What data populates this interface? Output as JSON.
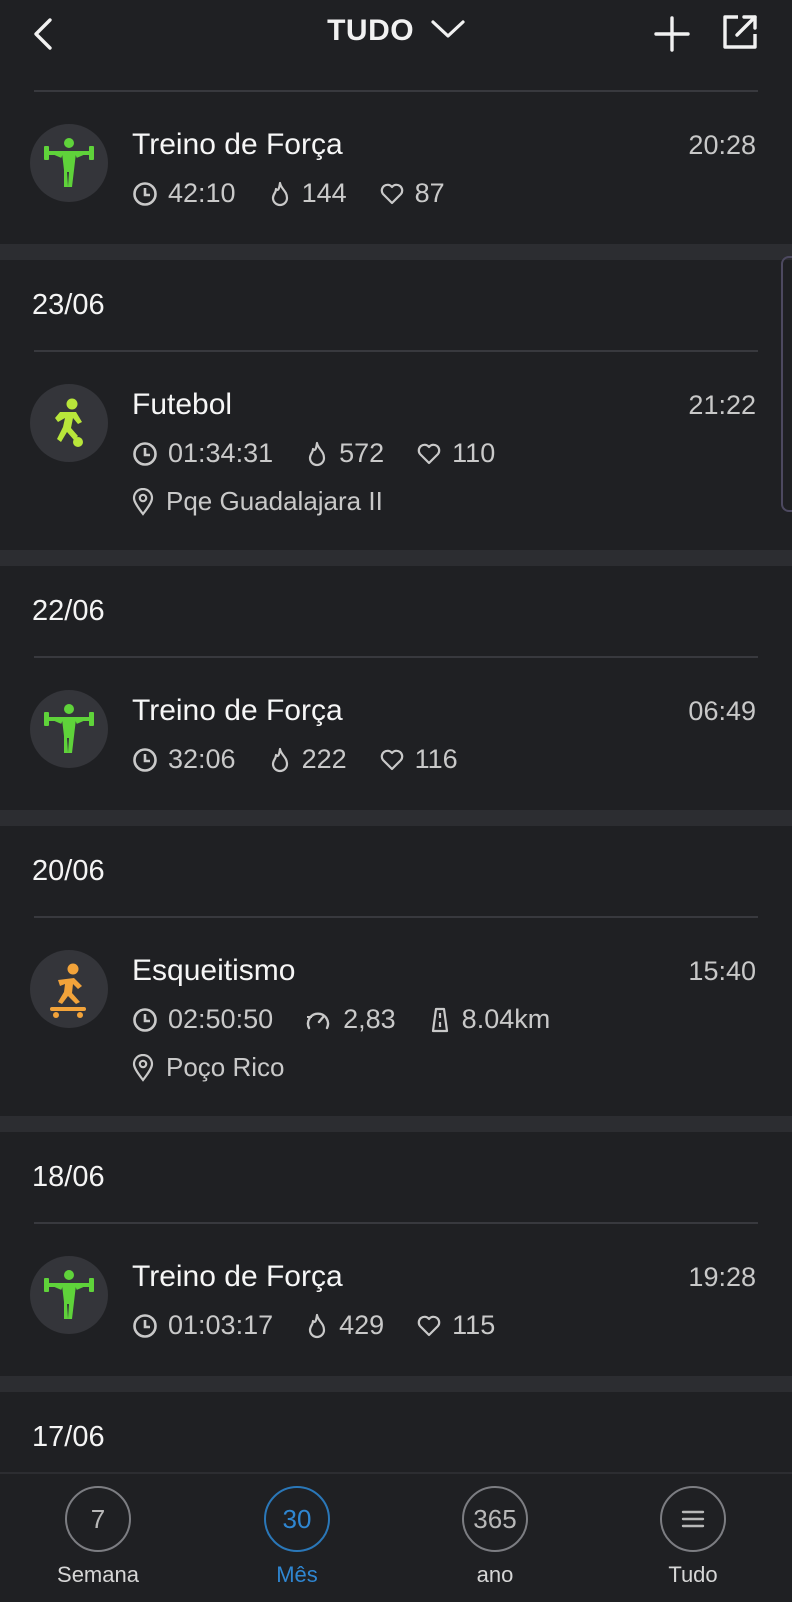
{
  "header": {
    "title": "TUDO",
    "back_icon": "chevron-left-icon",
    "add_icon": "plus-icon",
    "share_icon": "external-link-icon"
  },
  "groups": [
    {
      "date": "",
      "entries": [
        {
          "activity": "Treino de Força",
          "icon": "strength-icon",
          "time": "20:28",
          "duration": "42:10",
          "calories": "144",
          "heart_rate": "87"
        }
      ]
    },
    {
      "date": "23/06",
      "entries": [
        {
          "activity": "Futebol",
          "icon": "soccer-icon",
          "time": "21:22",
          "duration": "01:34:31",
          "calories": "572",
          "heart_rate": "110",
          "location": "Pqe Guadalajara II"
        }
      ]
    },
    {
      "date": "22/06",
      "entries": [
        {
          "activity": "Treino de Força",
          "icon": "strength-icon",
          "time": "06:49",
          "duration": "32:06",
          "calories": "222",
          "heart_rate": "116"
        }
      ]
    },
    {
      "date": "20/06",
      "entries": [
        {
          "activity": "Esqueitismo",
          "icon": "skateboard-icon",
          "time": "15:40",
          "duration": "02:50:50",
          "speed": "2,83",
          "distance": "8.04km",
          "location": "Poço Rico"
        }
      ]
    },
    {
      "date": "18/06",
      "entries": [
        {
          "activity": "Treino de Força",
          "icon": "strength-icon",
          "time": "19:28",
          "duration": "01:03:17",
          "calories": "429",
          "heart_rate": "115"
        }
      ]
    },
    {
      "date": "17/06",
      "entries": []
    }
  ],
  "bottom_nav": [
    {
      "ring": "7",
      "label": "Semana",
      "active": false
    },
    {
      "ring": "30",
      "label": "Mês",
      "active": true
    },
    {
      "ring": "365",
      "label": "ano",
      "active": false
    },
    {
      "ring": "menu-icon",
      "label": "Tudo",
      "active": false
    }
  ],
  "colors": {
    "background": "#1f2023",
    "separator": "#2c2d31",
    "strength_icon": "#5fd33a",
    "soccer_icon": "#b8e63a",
    "skate_icon": "#f2a33a",
    "active_tab": "#2f86d1"
  }
}
